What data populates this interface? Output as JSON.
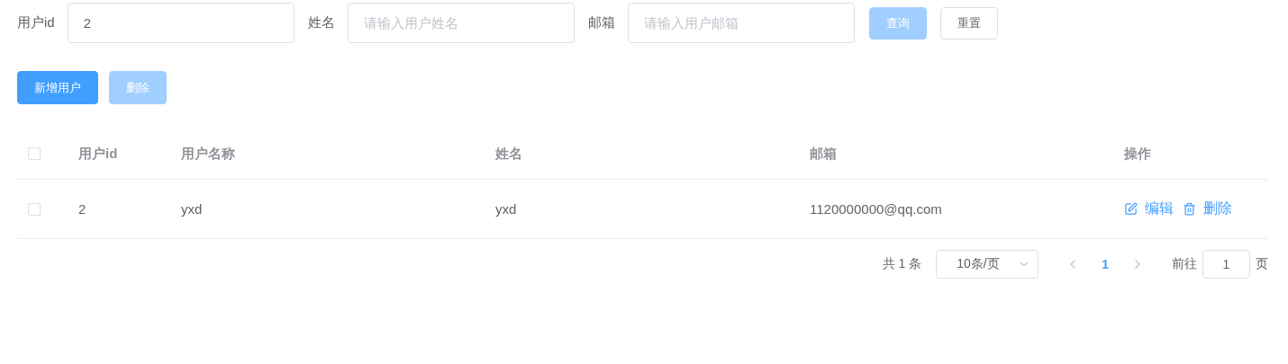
{
  "search": {
    "fields": [
      {
        "label": "用户id",
        "value": "2"
      },
      {
        "label": "姓名",
        "placeholder": "请输入用户姓名"
      },
      {
        "label": "邮箱",
        "placeholder": "请输入用户邮箱"
      }
    ],
    "buttons": [
      {
        "label": "查询",
        "kind": "primary",
        "hover": true
      },
      {
        "label": "重置",
        "kind": "default",
        "hover": false
      }
    ]
  },
  "toolbar": [
    {
      "label": "新增用户",
      "kind": "primary",
      "disabled": false
    },
    {
      "label": "删除",
      "kind": "primary",
      "disabled": true
    }
  ],
  "table": {
    "header_checked": false,
    "columns": [
      "用户id",
      "用户名称",
      "姓名",
      "邮箱",
      "操作"
    ],
    "rows": [
      {
        "checked": false,
        "cells": [
          "2",
          "yxd",
          "yxd",
          "1120000000@qq.com"
        ],
        "actions": [
          {
            "label": "编辑",
            "kind": "edit"
          },
          {
            "label": "删除",
            "kind": "delete"
          }
        ]
      }
    ]
  },
  "pagination": {
    "total": "共 1 条",
    "page_size": "10条/页",
    "pages": [
      {
        "label": "1",
        "selected": true
      }
    ],
    "prev_disabled": true,
    "next_disabled": true,
    "goto_label": "前往",
    "goto_value": "1",
    "goto_suffix": "页"
  }
}
